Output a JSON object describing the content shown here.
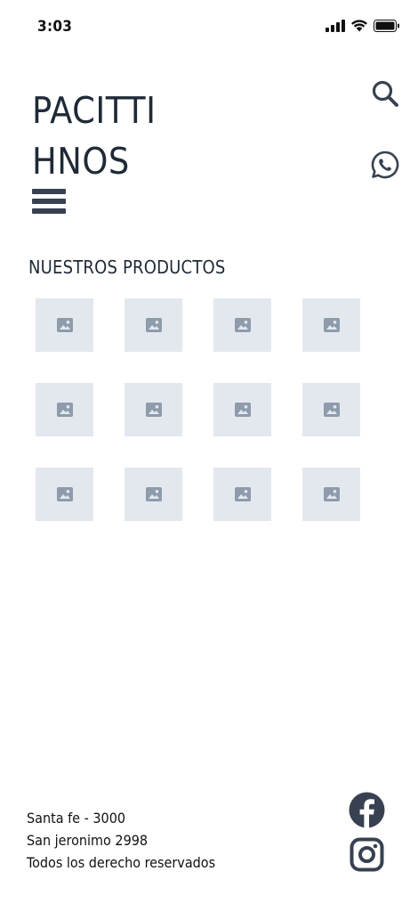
{
  "status_bar": {
    "time": "3:03",
    "icons": [
      "signal-icon",
      "wifi-icon",
      "battery-icon"
    ]
  },
  "header": {
    "brand_line1": "PACITTI",
    "brand_line2": "HNOS",
    "icons": [
      "search-icon",
      "whatsapp-icon",
      "menu-icon"
    ]
  },
  "products": {
    "title": "NUESTROS PRODUCTOS",
    "tiles": [
      {
        "icon": "image-placeholder-icon"
      },
      {
        "icon": "image-placeholder-icon"
      },
      {
        "icon": "image-placeholder-icon"
      },
      {
        "icon": "image-placeholder-icon"
      },
      {
        "icon": "image-placeholder-icon"
      },
      {
        "icon": "image-placeholder-icon"
      },
      {
        "icon": "image-placeholder-icon"
      },
      {
        "icon": "image-placeholder-icon"
      },
      {
        "icon": "image-placeholder-icon"
      },
      {
        "icon": "image-placeholder-icon"
      },
      {
        "icon": "image-placeholder-icon"
      },
      {
        "icon": "image-placeholder-icon"
      }
    ]
  },
  "footer": {
    "line1": "Santa fe - 3000",
    "line2": "San jeronimo 2998",
    "line3": "Todos los derecho reservados",
    "icons": [
      "facebook-icon",
      "instagram-icon"
    ]
  },
  "colors": {
    "text": "#1f2937",
    "tile": "#e3e8ef",
    "tile_icon": "#8e9bab",
    "icon": "#374151"
  }
}
